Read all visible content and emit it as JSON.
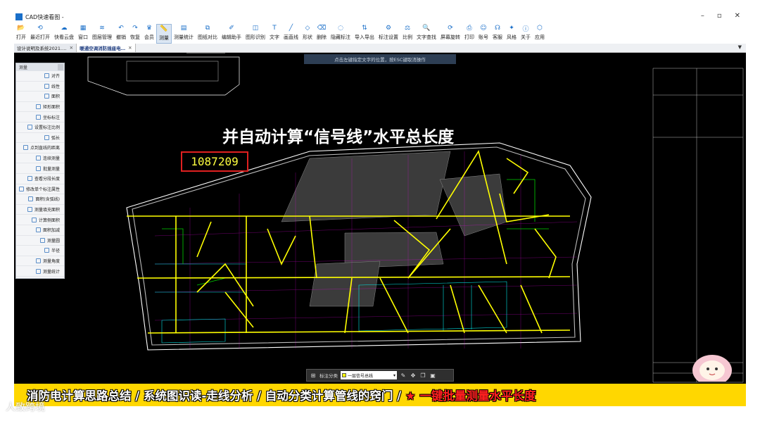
{
  "window": {
    "title": "CAD快速看图 -",
    "controls": [
      "–",
      "▫",
      "✕"
    ]
  },
  "toolbar": {
    "items": [
      {
        "label": "打开",
        "icon": "folder-icon"
      },
      {
        "label": "最近打开",
        "icon": "history-icon"
      },
      {
        "label": "快看云盘",
        "icon": "cloud-icon"
      },
      {
        "label": "窗口",
        "icon": "window-icon"
      },
      {
        "label": "图层管理",
        "icon": "layers-icon"
      },
      {
        "label": "撤销",
        "icon": "undo-icon"
      },
      {
        "label": "恢复",
        "icon": "redo-icon"
      },
      {
        "label": "会员",
        "icon": "vip-icon"
      },
      {
        "label": "测量",
        "icon": "measure-icon"
      },
      {
        "label": "测量统计",
        "icon": "measure-stats-icon"
      },
      {
        "label": "图纸对比",
        "icon": "compare-icon"
      },
      {
        "label": "编辑助手",
        "icon": "edit-helper-icon"
      },
      {
        "label": "图形识别",
        "icon": "recognize-icon"
      },
      {
        "label": "文字",
        "icon": "text-icon"
      },
      {
        "label": "画直线",
        "icon": "line-icon"
      },
      {
        "label": "形状",
        "icon": "shape-icon"
      },
      {
        "label": "删除",
        "icon": "eraser-icon"
      },
      {
        "label": "隐藏标注",
        "icon": "hide-icon"
      },
      {
        "label": "导入导出",
        "icon": "import-export-icon"
      },
      {
        "label": "标注设置",
        "icon": "annotation-settings-icon"
      },
      {
        "label": "比例",
        "icon": "scale-icon"
      },
      {
        "label": "文字查找",
        "icon": "text-search-icon"
      },
      {
        "label": "屏幕旋转",
        "icon": "rotate-icon"
      },
      {
        "label": "打印",
        "icon": "print-icon"
      },
      {
        "label": "账号",
        "icon": "user-icon"
      },
      {
        "label": "客服",
        "icon": "headset-icon"
      },
      {
        "label": "风格",
        "icon": "style-icon"
      },
      {
        "label": "关于",
        "icon": "info-icon"
      },
      {
        "label": "应用",
        "icon": "apps-icon"
      }
    ]
  },
  "tabs": [
    {
      "label": "设计说明及系统2021.…",
      "close": "✕"
    },
    {
      "label": "暖通空调消防插座电…",
      "close": "✕",
      "active": true
    }
  ],
  "tab_menu_arrow": "▼",
  "hint": "点击左键指定文字的位置，按ESC键取消操作",
  "panel": {
    "title": "测量",
    "items": [
      "对齐",
      "线性",
      "面积",
      "矩形面积",
      "坐标标注",
      "设置标注比例",
      "弧长",
      "点到直线的距离",
      "连续测量",
      "批量测量",
      "查看分段长度",
      "修改单个标注属性",
      "面积(含弧线)",
      "测量填充面积",
      "计算侧面积",
      "面积加减",
      "测量圆",
      "半径",
      "测量角度",
      "测量统计"
    ]
  },
  "overlay": {
    "caption": "并自动计算“信号线”水平总长度",
    "value": "1087209"
  },
  "bottom_bar": {
    "label": "标注分类",
    "selected": "一层信号总线",
    "icons": [
      "grid-icon",
      "edit-icon",
      "move-icon",
      "copy-icon",
      "paste-icon"
    ]
  },
  "banner": {
    "text": "消防电计算思路总结 / 系统图识读-走线分析 / 自动分类计算管线的窍门 / ",
    "highlight": "★ 一键批量测量水平长度"
  },
  "watermark": "人致跨境",
  "colors": {
    "canvas": "#000000",
    "signal_line": "#ffff00",
    "wall": "#ffffff",
    "detail": "#ff00ff",
    "cyan": "#00e5e5",
    "banner": "#ffd700"
  }
}
